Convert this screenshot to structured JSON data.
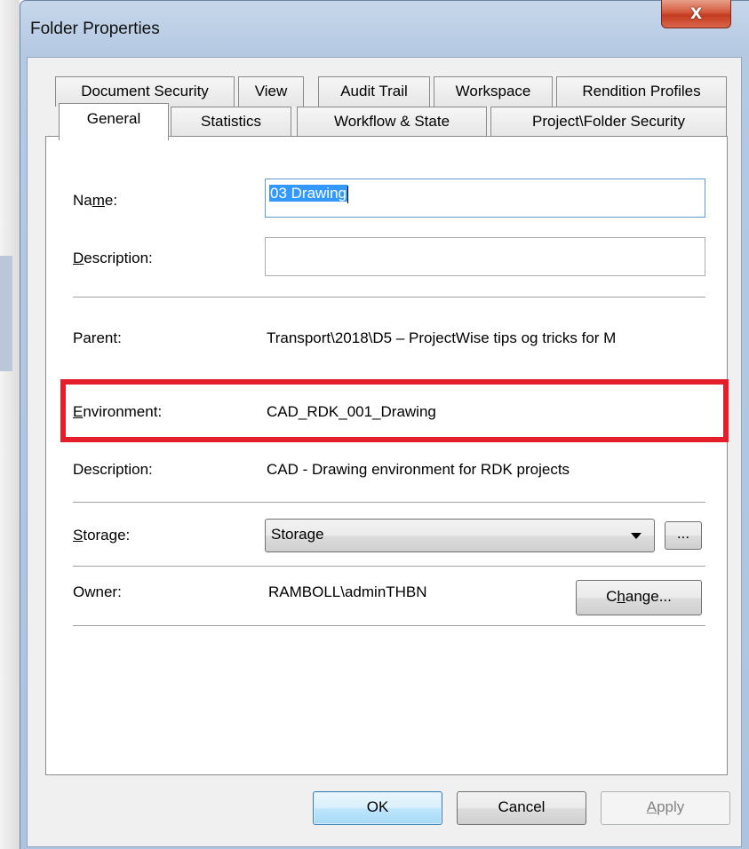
{
  "window": {
    "title": "Folder Properties",
    "close_label": "X"
  },
  "tabs": {
    "row_back": [
      {
        "label": "Document Security"
      },
      {
        "label": "View"
      },
      {
        "label": "Audit Trail"
      },
      {
        "label": "Workspace"
      },
      {
        "label": "Rendition Profiles"
      }
    ],
    "row_front": [
      {
        "label": "General",
        "active": true
      },
      {
        "label": "Statistics"
      },
      {
        "label": "Workflow & State"
      },
      {
        "label": "Project\\Folder Security"
      }
    ]
  },
  "general": {
    "name": {
      "label_pre": "Na",
      "label_mnemonic": "m",
      "label_post": "e:",
      "value": "03 Drawing"
    },
    "description": {
      "label_mnemonic": "D",
      "label_post": "escription:",
      "value": ""
    },
    "parent": {
      "label": "Parent:",
      "value": "Transport\\2018\\D5 – ProjectWise tips og tricks for M"
    },
    "environment": {
      "label_mnemonic": "E",
      "label_post": "nvironment:",
      "value": "CAD_RDK_001_Drawing"
    },
    "env_description": {
      "label": "Description:",
      "value": "CAD - Drawing environment for RDK projects"
    },
    "storage": {
      "label_mnemonic": "S",
      "label_post": "torage:",
      "selected": "Storage",
      "browse_label": "..."
    },
    "owner": {
      "label": "Owner:",
      "value": "RAMBOLL\\adminTHBN",
      "change_pre": "C",
      "change_mnemonic": "h",
      "change_post": "ange..."
    }
  },
  "buttons": {
    "ok": "OK",
    "cancel": "Cancel",
    "apply_mnemonic": "A",
    "apply_post": "pply"
  }
}
